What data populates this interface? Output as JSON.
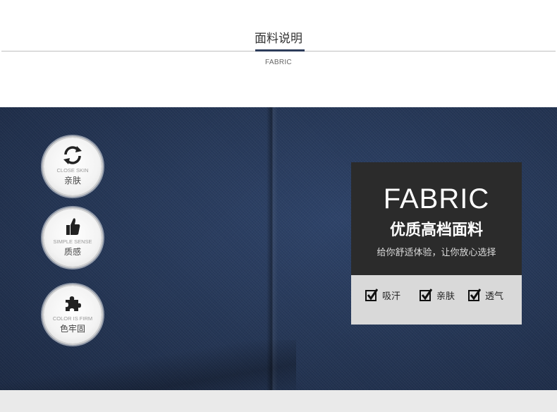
{
  "header": {
    "title": "面料说明",
    "subtitle": "FABRIC"
  },
  "badges": [
    {
      "icon": "refresh-arrows-icon",
      "en": "CLOSE SKIN",
      "cn": "亲肤"
    },
    {
      "icon": "thumbs-up-icon",
      "en": "SIMPLE SENSE",
      "cn": "质感"
    },
    {
      "icon": "puzzle-piece-icon",
      "en": "COLOR IS FIRM",
      "cn": "色牢固"
    }
  ],
  "panel": {
    "title": "FABRIC",
    "subtitle": "优质高档面料",
    "description": "给你舒适体验，让你放心选择",
    "features": [
      "吸汗",
      "亲肤",
      "透气"
    ]
  },
  "colors": {
    "fabric": "#263858",
    "panel_dark": "#2b2b2b",
    "panel_light": "#d9d9d9",
    "accent": "#2d3c5a"
  }
}
